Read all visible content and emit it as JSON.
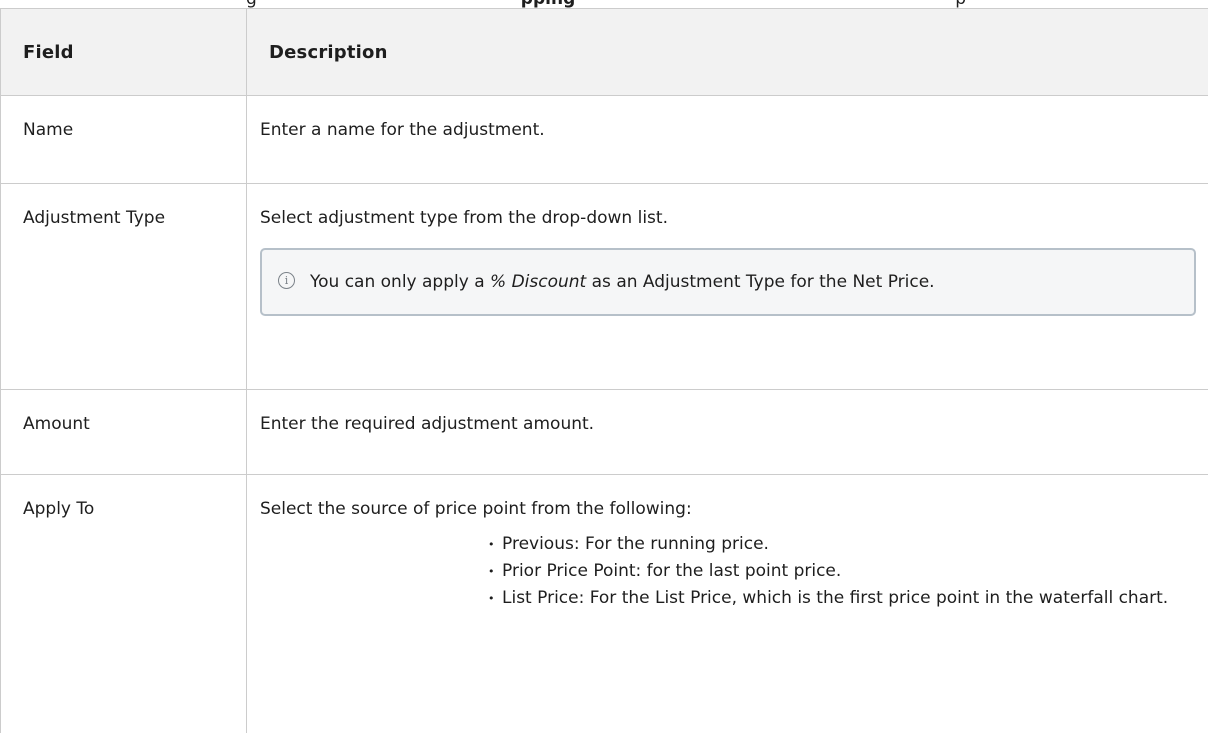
{
  "header_clip": {
    "prefix": "g",
    "bold": "pping",
    "suffix": "p"
  },
  "table": {
    "headers": {
      "field": "Field",
      "description": "Description"
    },
    "rows": {
      "name": {
        "field": "Name",
        "description": "Enter a name for the adjustment."
      },
      "type": {
        "field": "Adjustment Type",
        "description": "Select adjustment type from the drop-down list.",
        "note": {
          "icon": "info-icon",
          "before": "You can only apply a ",
          "emph": "% Discount",
          "after": " as an Adjustment Type for the Net Price."
        }
      },
      "amount": {
        "field": "Amount",
        "description": "Enter the required adjustment amount."
      },
      "apply": {
        "field": "Apply To",
        "description": "Select the source of price point from the following:",
        "options": [
          "Previous: For the running price.",
          "Prior Price Point: for the last point price.",
          "List Price: For the List Price, which is the first price point in the waterfall chart."
        ]
      }
    }
  }
}
